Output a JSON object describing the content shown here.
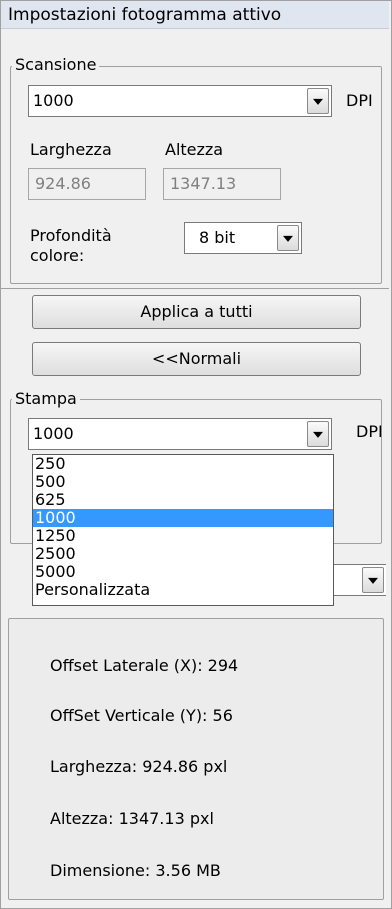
{
  "panel_title": "Impostazioni fotogramma attivo",
  "scan": {
    "group_label": "Scansione",
    "dpi_value": "1000",
    "dpi_unit": "DPI",
    "width_label": "Larghezza",
    "height_label": "Altezza",
    "width_value": "924.86",
    "height_value": "1347.13",
    "depth_label_line1": "Profondità",
    "depth_label_line2": "colore:",
    "depth_value": "8 bit"
  },
  "buttons": {
    "apply_all": "Applica a tutti",
    "normal": "<<Normali"
  },
  "print": {
    "group_label": "Stampa",
    "dpi_value": "1000",
    "dpi_unit": "DPI",
    "options": [
      "250",
      "500",
      "625",
      "1000",
      "1250",
      "2500",
      "5000",
      "Personalizzata"
    ],
    "selected_index": 3
  },
  "info": {
    "offset_x": "Offset Laterale (X): 294",
    "offset_y": "OffSet Verticale (Y): 56",
    "width": "Larghezza: 924.86 pxl",
    "height": "Altezza: 1347.13 pxl",
    "size": "Dimensione: 3.56 MB"
  }
}
